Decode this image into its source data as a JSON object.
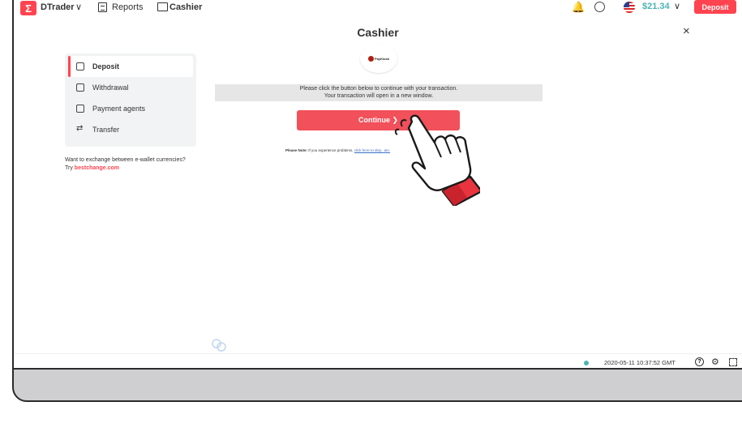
{
  "header": {
    "logo_glyph": "Σ",
    "app_name": "DTrader",
    "chevron": "∨",
    "reports_label": "Reports",
    "cashier_label": "Cashier",
    "bell_glyph": "🔔",
    "balance": "$21.34",
    "balance_chevron": "∨",
    "deposit_label": "Deposit"
  },
  "page": {
    "title": "Cashier",
    "close": "×"
  },
  "sidebar": {
    "items": [
      {
        "label": "Deposit",
        "icon": "wallet-icon",
        "active": true
      },
      {
        "label": "Withdrawal",
        "icon": "wallet-icon",
        "active": false
      },
      {
        "label": "Payment agents",
        "icon": "payment-agent-icon",
        "active": false
      },
      {
        "label": "Transfer",
        "icon": "transfer-arrows-icon",
        "active": false
      }
    ],
    "ewallet_text": "Want to exchange between e-wallet currencies? Try ",
    "ewallet_link": "bestchange.com"
  },
  "main": {
    "brand_text": "PayKiosk",
    "info_line1": "Please click the button below to continue with your transaction.",
    "info_line2": "Your transaction will open in a new window.",
    "continue_label": "Continue ❯",
    "note_label": "Please Note:",
    "note_text": " If you experience problems, ",
    "note_link": "click here to skip...",
    "note_tail": "ain."
  },
  "footer": {
    "timestamp": "2020-05-11 10:37:52 GMT",
    "help": "?",
    "gear": "⚙"
  },
  "colors": {
    "brand_red": "#ff444f",
    "balance_teal": "#4bb4b3"
  }
}
